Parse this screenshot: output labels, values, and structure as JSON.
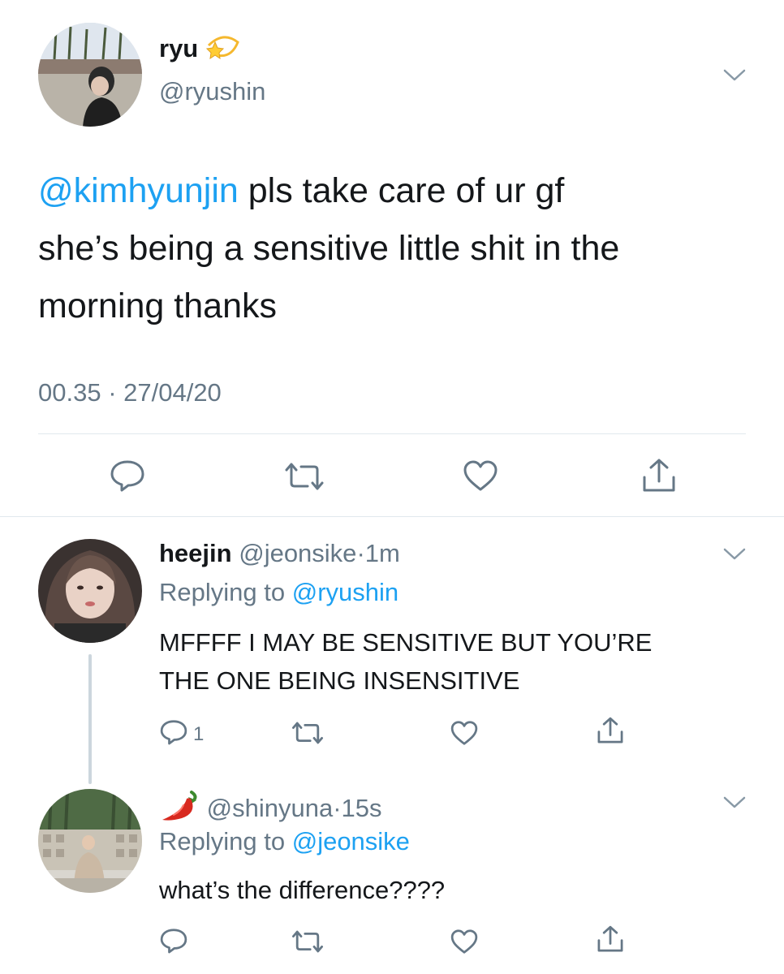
{
  "main_tweet": {
    "display_name": "ryu",
    "handle": "@ryushin",
    "mention": "@kimhyunjin",
    "text_line1": " pls take care of ur gf",
    "text_line2": "she’s being a sensitive little shit in the",
    "text_line3": "morning thanks",
    "timestamp": "00.35 · 27/04/20",
    "icons": [
      "reply-icon",
      "retweet-icon",
      "like-icon",
      "share-icon"
    ]
  },
  "replies": [
    {
      "display_name": "heejin",
      "handle": "@jeonsike",
      "time": "1m",
      "replying_label": "Replying to",
      "replying_to": "@ryushin",
      "text_line1": "MFFFF I MAY BE SENSITIVE BUT YOU’RE",
      "text_line2": "THE ONE BEING INSENSITIVE",
      "reply_count": "1"
    },
    {
      "display_name": "",
      "handle": "@shinyuna",
      "time": "15s",
      "replying_label": "Replying to",
      "replying_to": "@jeonsike",
      "text_line1": "what’s the difference????"
    }
  ],
  "separator": "·",
  "colors": {
    "link": "#1da1f2",
    "secondary": "#657786",
    "text": "#14171a",
    "divider": "#e1e8ed"
  }
}
